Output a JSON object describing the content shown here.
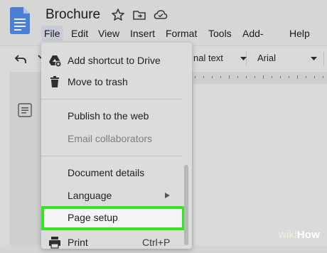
{
  "document": {
    "title": "Brochure"
  },
  "menubar": {
    "items": [
      "File",
      "Edit",
      "View",
      "Insert",
      "Format",
      "Tools",
      "Add-ons",
      "Help"
    ]
  },
  "toolbar": {
    "style_value": "nal text",
    "font_value": "Arial"
  },
  "file_menu": {
    "items": [
      {
        "label": "Add shortcut to Drive",
        "icon": "drive-shortcut-icon",
        "enabled": true
      },
      {
        "label": "Move to trash",
        "icon": "trash-icon",
        "enabled": true
      },
      {
        "label": "Publish to the web",
        "enabled": true
      },
      {
        "label": "Email collaborators",
        "enabled": false
      },
      {
        "label": "Document details",
        "enabled": true
      },
      {
        "label": "Language",
        "enabled": true,
        "submenu": true
      },
      {
        "label": "Page setup",
        "enabled": true,
        "highlighted": true
      },
      {
        "label": "Print",
        "icon": "print-icon",
        "shortcut": "Ctrl+P",
        "enabled": true
      }
    ]
  },
  "watermark": {
    "wiki": "wiki",
    "how": "How"
  },
  "colors": {
    "highlight": "#32e622",
    "docs_blue": "#4a7fd4"
  }
}
